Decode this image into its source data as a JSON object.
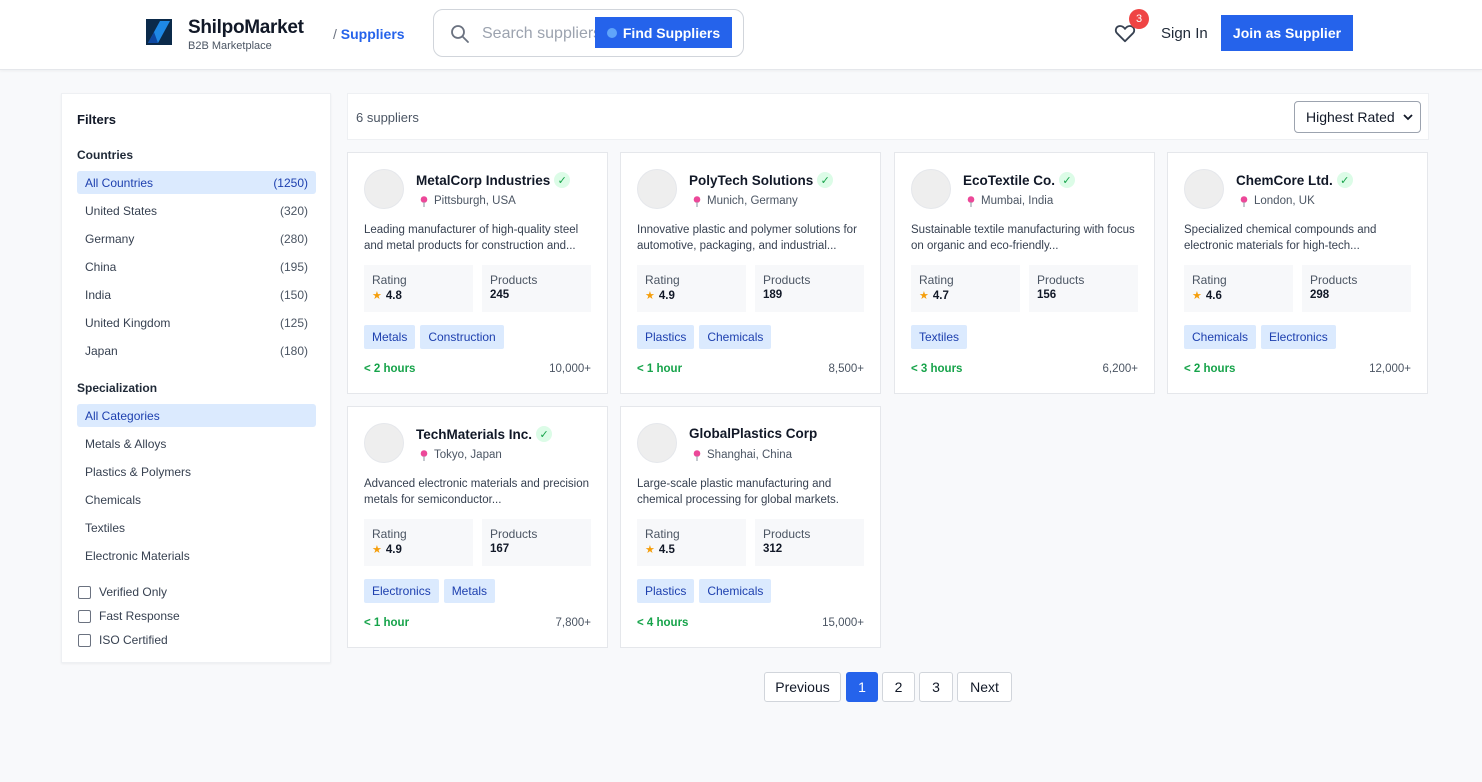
{
  "brand": {
    "name": "ShilpoMarket",
    "tagline": "B2B Marketplace",
    "breadcrumb_sep": "/",
    "breadcrumb": "Suppliers"
  },
  "search": {
    "placeholder": "Search suppliers",
    "button_label": "Find Suppliers"
  },
  "header": {
    "favorites_count": "3",
    "signin_label": "Sign In",
    "join_label": "Join as Supplier"
  },
  "filters": {
    "title": "Filters",
    "countries_title": "Countries",
    "countries": [
      {
        "label": "All Countries",
        "count": "(1250)"
      },
      {
        "label": "United States",
        "count": "(320)"
      },
      {
        "label": "Germany",
        "count": "(280)"
      },
      {
        "label": "China",
        "count": "(195)"
      },
      {
        "label": "India",
        "count": "(150)"
      },
      {
        "label": "United Kingdom",
        "count": "(125)"
      },
      {
        "label": "Japan",
        "count": "(180)"
      }
    ],
    "specialization_title": "Specialization",
    "specializations": [
      {
        "label": "All Categories"
      },
      {
        "label": "Metals & Alloys"
      },
      {
        "label": "Plastics & Polymers"
      },
      {
        "label": "Chemicals"
      },
      {
        "label": "Textiles"
      },
      {
        "label": "Electronic Materials"
      }
    ],
    "checkboxes": [
      {
        "label": "Verified Only"
      },
      {
        "label": "Fast Response"
      },
      {
        "label": "ISO Certified"
      }
    ]
  },
  "results": {
    "count_text": "6 suppliers",
    "sort_selected": "Highest Rated",
    "rating_label": "Rating",
    "products_label": "Products"
  },
  "suppliers": [
    {
      "name": "MetalCorp Industries",
      "verified": true,
      "location": "Pittsburgh, USA",
      "description": "Leading manufacturer of high-quality steel and metal products for construction and...",
      "rating": "4.8",
      "products": "245",
      "tags": [
        "Metals",
        "Construction"
      ],
      "response": "< 2 hours",
      "orders": "10,000+"
    },
    {
      "name": "PolyTech Solutions",
      "verified": true,
      "location": "Munich, Germany",
      "description": "Innovative plastic and polymer solutions for automotive, packaging, and industrial...",
      "rating": "4.9",
      "products": "189",
      "tags": [
        "Plastics",
        "Chemicals"
      ],
      "response": "< 1 hour",
      "orders": "8,500+"
    },
    {
      "name": "EcoTextile Co.",
      "verified": true,
      "location": "Mumbai, India",
      "description": "Sustainable textile manufacturing with focus on organic and eco-friendly...",
      "rating": "4.7",
      "products": "156",
      "tags": [
        "Textiles"
      ],
      "response": "< 3 hours",
      "orders": "6,200+"
    },
    {
      "name": "ChemCore Ltd.",
      "verified": true,
      "location": "London, UK",
      "description": "Specialized chemical compounds and electronic materials for high-tech...",
      "rating": "4.6",
      "products": "298",
      "tags": [
        "Chemicals",
        "Electronics"
      ],
      "response": "< 2 hours",
      "orders": "12,000+"
    },
    {
      "name": "TechMaterials Inc.",
      "verified": true,
      "location": "Tokyo, Japan",
      "description": "Advanced electronic materials and precision metals for semiconductor...",
      "rating": "4.9",
      "products": "167",
      "tags": [
        "Electronics",
        "Metals"
      ],
      "response": "< 1 hour",
      "orders": "7,800+"
    },
    {
      "name": "GlobalPlastics Corp",
      "verified": false,
      "location": "Shanghai, China",
      "description": "Large-scale plastic manufacturing and chemical processing for global markets.",
      "rating": "4.5",
      "products": "312",
      "tags": [
        "Plastics",
        "Chemicals"
      ],
      "response": "< 4 hours",
      "orders": "15,000+"
    }
  ],
  "pagination": {
    "previous": "Previous",
    "pages": [
      "1",
      "2",
      "3"
    ],
    "next": "Next"
  },
  "colors": {
    "accent": "#2563eb",
    "tag_bg": "#dbeafe",
    "response_green": "#16a34a",
    "badge_red": "#ef4444"
  }
}
